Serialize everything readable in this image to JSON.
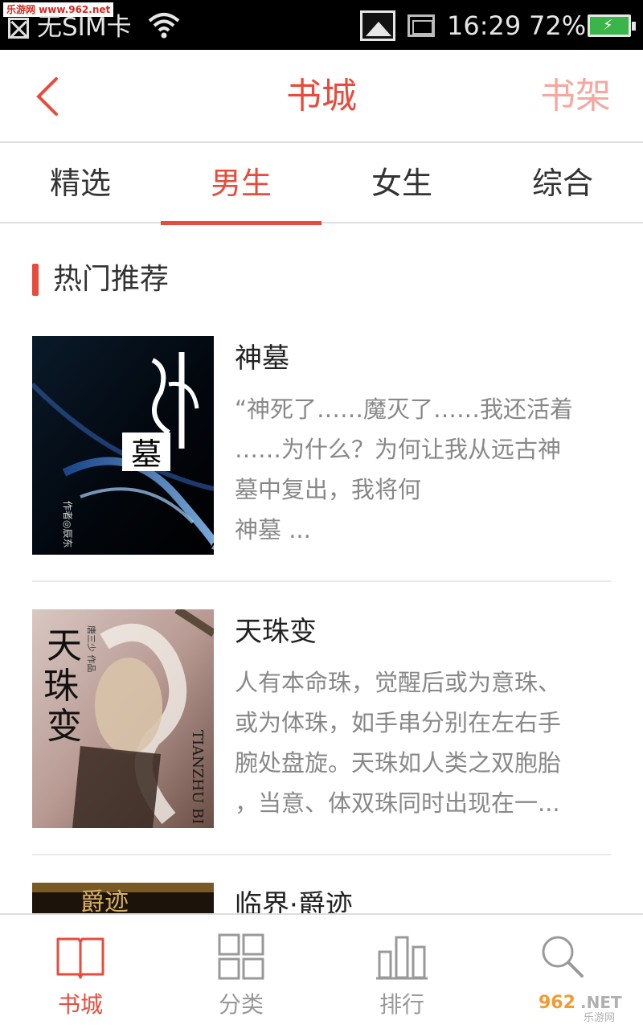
{
  "status_bar": {
    "watermark": "乐游网 www.962.net",
    "carrier": "无SIM卡",
    "time": "16:29",
    "battery_percent": "72%",
    "battery_level": 0.72
  },
  "header": {
    "title": "书城",
    "bookshelf_label": "书架"
  },
  "tabs": [
    {
      "label": "精选",
      "active": false
    },
    {
      "label": "男生",
      "active": true
    },
    {
      "label": "女生",
      "active": false
    },
    {
      "label": "综合",
      "active": false
    }
  ],
  "section": {
    "title": "热门推荐"
  },
  "books": [
    {
      "title": "神墓",
      "desc_lines": [
        "“神死了……魔灭了……我还活着",
        "……为什么？为何让我从远古神",
        "墓中复出，我将何",
        "神墓 ..."
      ],
      "cover_text": "神",
      "cover_subtext": "墓",
      "cover_author": "作者◎辰东"
    },
    {
      "title": "天珠变",
      "desc_lines": [
        "人有本命珠，觉醒后或为意珠、",
        "或为体珠，如手串分别在左右手",
        "腕处盘旋。天珠如人类之双胞胎",
        "，当意、体双珠同时出现在一..."
      ],
      "cover_text": "天珠变",
      "cover_side_text": "TIANZHU BI",
      "cover_author": "唐三少 作品"
    },
    {
      "title": "临界·爵迹",
      "cover_text": "爵迹"
    }
  ],
  "bottom_nav": [
    {
      "label": "书城",
      "icon": "book-open-icon",
      "active": true
    },
    {
      "label": "分类",
      "icon": "grid-icon",
      "active": false
    },
    {
      "label": "排行",
      "icon": "bar-chart-icon",
      "active": false
    },
    {
      "label": "",
      "icon": "search-icon",
      "active": false
    }
  ],
  "watermark_logo": "962.NET 乐游网",
  "colors": {
    "accent": "#e84b3c",
    "accent_light": "#f4a89f",
    "text_dark": "#333333",
    "text_gray": "#888888",
    "nav_gray": "#999999"
  }
}
